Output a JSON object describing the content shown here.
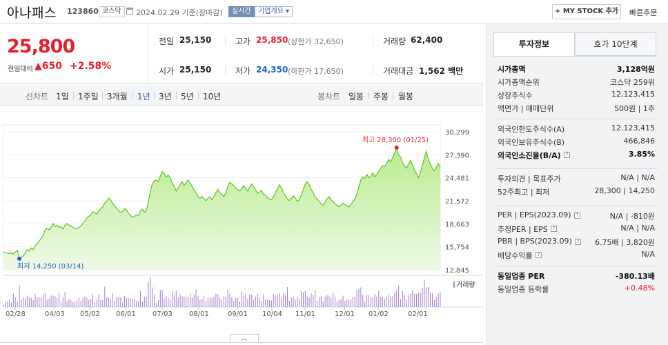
{
  "header": {
    "stock_name": "아나패스",
    "stock_code": "123860",
    "market": "코스닥",
    "date_text": "2024.02.29 기준(장마감)",
    "live_label": "실시간",
    "overview_label": "기업개요",
    "mystock_label": "+ MY STOCK 추가",
    "quick_order_label": "빠른주문"
  },
  "price": {
    "current": "25,800",
    "diff_label": "전일대비",
    "diff_amount": "▲650",
    "diff_pct": "+2.58%",
    "rows": [
      {
        "label": "전일",
        "value": "25,150",
        "label2": "고가",
        "value2": "25,850",
        "sub2": "(상한가 32,650)",
        "label3": "거래량",
        "value3": "62,400"
      },
      {
        "label": "시가",
        "value": "25,150",
        "label2": "저가",
        "value2": "24,350",
        "sub2": "(하한가 17,650)",
        "label3": "거래대금",
        "value3": "1,562 백만"
      }
    ]
  },
  "period_bar": {
    "line_label": "선차트",
    "periods": [
      "1일",
      "1주일",
      "3개월",
      "1년",
      "3년",
      "5년",
      "10년"
    ],
    "selected": "1년",
    "candle_label": "봉차트",
    "candles": [
      "일봉",
      "주봉",
      "월봉"
    ]
  },
  "chart_data": {
    "type": "area",
    "y_ticks": [
      "30,299",
      "27,390",
      "24,481",
      "21,572",
      "18,663",
      "15,754",
      "12,845"
    ],
    "ylim": [
      12845,
      30299
    ],
    "x_ticks": [
      "02/28",
      "04/03",
      "05/02",
      "06/01",
      "07/03",
      "08/01",
      "09/01",
      "10/04",
      "11/01",
      "12/01",
      "01/02",
      "02/01"
    ],
    "high_label": "최고 28,300 (01/25)",
    "low_label": "최저 14,250 (03/14)",
    "volume_label": "거래량",
    "values": [
      15100,
      15000,
      14950,
      14900,
      15000,
      14850,
      15100,
      15300,
      14250,
      14400,
      14600,
      15000,
      15400,
      15200,
      15600,
      15400,
      15900,
      16100,
      16500,
      16800,
      17200,
      17900,
      18100,
      17900,
      18200,
      18700,
      18300,
      18500,
      18200,
      18300,
      18000,
      18500,
      18700,
      18500,
      18400,
      18200,
      18100,
      18000,
      18200,
      18400,
      18700,
      19000,
      19400,
      19600,
      19800,
      20200,
      20100,
      19900,
      20300,
      20600,
      20800,
      21300,
      21500,
      21900,
      21700,
      21200,
      21000,
      20600,
      20300,
      20100,
      20200,
      20600,
      20400,
      20000,
      19700,
      19500,
      19600,
      19800,
      19700,
      20300,
      20500,
      20100,
      20400,
      21500,
      22800,
      23700,
      24100,
      24200,
      24000,
      24700,
      25300,
      25000,
      24600,
      24800,
      24500,
      23800,
      23400,
      22800,
      23200,
      23700,
      24000,
      23500,
      23900,
      24200,
      23800,
      23400,
      22900,
      22600,
      22100,
      21900,
      22100,
      21800,
      21600,
      21900,
      22100,
      21700,
      22100,
      22600,
      23000,
      22600,
      22400,
      22100,
      22600,
      23400,
      23900,
      23700,
      23500,
      23200,
      23000,
      22800,
      23100,
      23500,
      23100,
      22800,
      23300,
      23700,
      23400,
      23000,
      22500,
      22700,
      22900,
      22400,
      22300,
      22000,
      21800,
      21700,
      22100,
      22600,
      23100,
      23600,
      23200,
      22600,
      22200,
      21800,
      21600,
      21900,
      22200,
      21900,
      21500,
      21700,
      22300,
      23000,
      23700,
      24000,
      23600,
      23000,
      22600,
      22000,
      21800,
      21500,
      21200,
      21000,
      21400,
      21800,
      22100,
      21700,
      21500,
      21200,
      21000,
      20800,
      21000,
      21300,
      21100,
      20900,
      20800,
      21100,
      21500,
      21800,
      22400,
      23300,
      24200,
      24600,
      24400,
      24900,
      24500,
      24700,
      25100,
      24600,
      24900,
      25300,
      25700,
      26000,
      25900,
      26300,
      26800,
      26500,
      27000,
      27600,
      28300,
      27400,
      27100,
      26400,
      26000,
      25700,
      26200,
      26700,
      26100,
      25500,
      25000,
      24500,
      25200,
      26100,
      27000,
      27800,
      26800,
      26200,
      25700,
      25400,
      25800,
      26300,
      25800
    ]
  },
  "right_panel": {
    "tab_invest": "투자정보",
    "tab_orderbook": "호가 10단계",
    "sections": [
      [
        {
          "k": "시가총액",
          "v": "3,128억원",
          "bold": true
        },
        {
          "k": "시가총액순위",
          "v": "코스닥 259위"
        },
        {
          "k": "상장주식수",
          "v": "12,123,415"
        },
        {
          "k": "액면가 | 매매단위",
          "v": "500원 | 1주"
        }
      ],
      [
        {
          "k": "외국인한도주식수(A)",
          "v": "12,123,415"
        },
        {
          "k": "외국인보유주식수(B)",
          "v": "466,846"
        },
        {
          "k": "외국인소진율(B/A)",
          "v": "3.85%",
          "bold": true,
          "icon": true
        }
      ],
      [
        {
          "k": "투자의견 | 목표주가",
          "v": "N/A | N/A"
        },
        {
          "k": "52주최고 | 최저",
          "v": "28,300 | 14,250"
        }
      ],
      [
        {
          "k": "PER | EPS(2023.09)",
          "v": "N/A | -810원",
          "icon": true
        },
        {
          "k": "추정PER | EPS",
          "v": "N/A | N/A",
          "icon": true
        },
        {
          "k": "PBR | BPS(2023.09)",
          "v": "6.75배 | 3,820원",
          "icon": true
        },
        {
          "k": "배당수익률",
          "v": "N/A",
          "icon": true
        }
      ],
      [
        {
          "k": "동일업종 PER",
          "v": "-380.13배",
          "bold": true
        },
        {
          "k": "동일업종 등락률",
          "v": "+0.48%",
          "red": true
        }
      ]
    ]
  },
  "colors": {
    "up": "#e61f2e",
    "down": "#1e62c8",
    "area_line": "#5cc41f",
    "area_fill_top": "#b9ec8f",
    "volume_bar": "#a57fc9"
  }
}
